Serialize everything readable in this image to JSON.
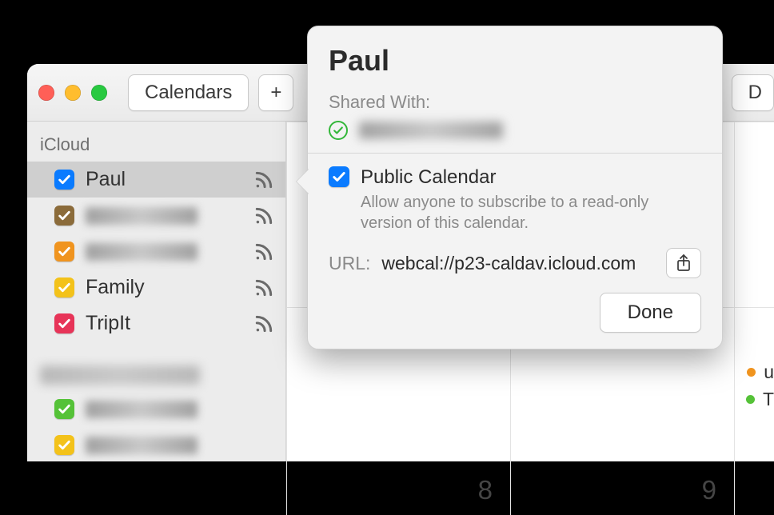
{
  "toolbar": {
    "calendars_button": "Calendars",
    "right_button": "D"
  },
  "sidebar": {
    "section": "iCloud",
    "items": [
      {
        "color": "#0a7bff",
        "label": "Paul",
        "shared": true,
        "selected": true,
        "blurred": false
      },
      {
        "color": "#8b6b3a",
        "label": "kaikr",
        "shared": true,
        "selected": false,
        "blurred": true
      },
      {
        "color": "#f0941f",
        "label": "mgadd",
        "shared": true,
        "selected": false,
        "blurred": true
      },
      {
        "color": "#f3c21a",
        "label": "Family",
        "shared": true,
        "selected": false,
        "blurred": false
      },
      {
        "color": "#e73458",
        "label": "TripIt",
        "shared": true,
        "selected": false,
        "blurred": false
      }
    ],
    "items2": [
      {
        "color": "#55c238"
      },
      {
        "color": "#f3c21a"
      }
    ]
  },
  "grid": {
    "days": [
      "8",
      "9"
    ],
    "events": [
      {
        "color": "#f0941f",
        "label": "u"
      },
      {
        "color": "#55c238",
        "label": "T"
      }
    ]
  },
  "popover": {
    "title": "Paul",
    "shared_with": "Shared With:",
    "public_label": "Public Calendar",
    "public_desc": "Allow anyone to subscribe to a read-only version of this calendar.",
    "url_label": "URL:",
    "url_value": "webcal://p23-caldav.icloud.com",
    "done": "Done"
  }
}
